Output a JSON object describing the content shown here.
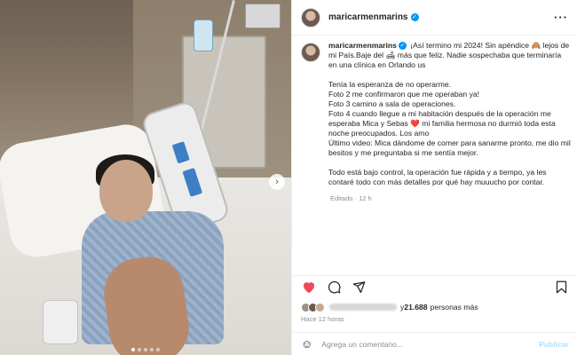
{
  "post": {
    "username": "maricarmenmarins",
    "more_icon": "ellipsis-icon",
    "caption_line1": " ¡Así termino mi 2024! Sin apéndice 🙈 lejos de mi País.Baje del 🛋 más que feliz. Nadie sospechaba que terminaría en una clínica en Orlando us",
    "caption_paragraphs": [
      "Tenía la esperanza de no operarme.",
      "Foto 2 me confirmaron que me operaban ya!",
      "Foto 3 camino a sala de operaciones.",
      "Foto 4 cuando llegue a mi habitación después de la operación me esperaba Mica y Sebas ❤️ mi familia hermosa no durmió toda esta noche preocupados. Los amo",
      "Último video: Mica dándome de comer para sanarme pronto, me dio mil besitos y me preguntaba si me sentía mejor."
    ],
    "caption_final": "Todo está bajo control, la operación fue rápida y a tiempo, ya les contaré todo con más detalles por qué hay muuucho por contar.",
    "edited": "Editado · 12 h",
    "likes_count": "21.688",
    "likes_suffix": "personas más",
    "time_ago": "Hace 12 horas"
  },
  "comment": {
    "placeholder": "Agrega un comentario...",
    "publish_label": "Publicar"
  },
  "colors": {
    "like_red": "#ed4956",
    "verified_blue": "#0095f6"
  }
}
